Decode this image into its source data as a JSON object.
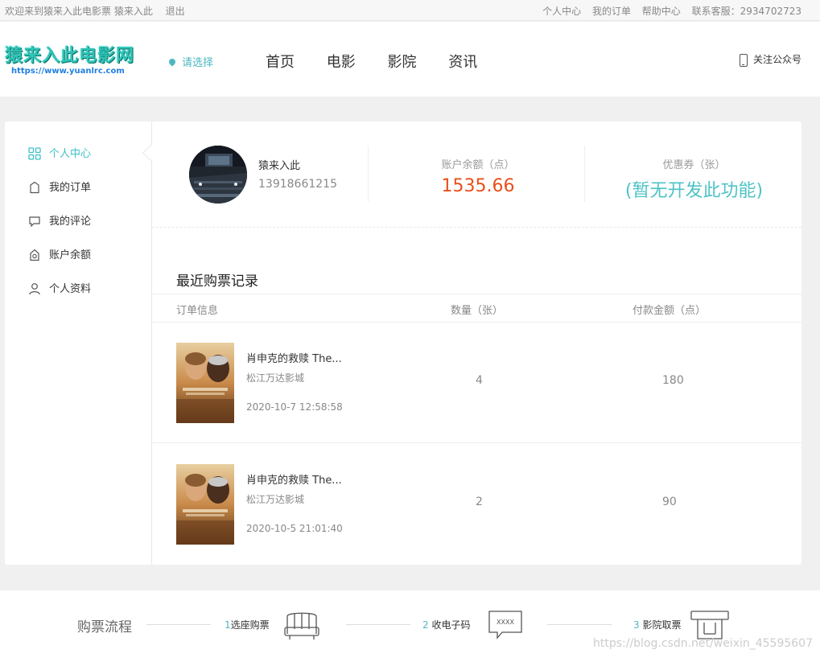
{
  "topbar": {
    "welcome": "欢迎来到猿来入此电影票 猿来入此",
    "logout": "退出",
    "links": [
      "个人中心",
      "我的订单",
      "帮助中心",
      "联系客服：2934702723"
    ]
  },
  "header": {
    "logo_name": "猿来入此电影网",
    "logo_url": "https://www.yuanlrc.com",
    "city_select": "请选择",
    "nav": [
      "首页",
      "电影",
      "影院",
      "资讯"
    ],
    "follow": "关注公众号"
  },
  "sidebar": {
    "items": [
      {
        "label": "个人中心",
        "icon": "grid-icon",
        "active": true
      },
      {
        "label": "我的订单",
        "icon": "bag-icon",
        "active": false
      },
      {
        "label": "我的评论",
        "icon": "comment-icon",
        "active": false
      },
      {
        "label": "账户余额",
        "icon": "wallet-icon",
        "active": false
      },
      {
        "label": "个人资料",
        "icon": "user-icon",
        "active": false
      }
    ]
  },
  "profile": {
    "username": "猿来入此",
    "phone": "13918661215",
    "balance_label": "账户余额（点）",
    "balance_value": "1535.66",
    "coupon_label": "优惠券（张）",
    "coupon_value": "(暂无开发此功能)"
  },
  "orders": {
    "title": "最近购票记录",
    "headers": {
      "info": "订单信息",
      "qty": "数量（张）",
      "amount": "付款金额（点）"
    },
    "rows": [
      {
        "movie": "肖申克的救赎 The...",
        "cinema": "松江万达影城",
        "time": "2020-10-7 12:58:58",
        "qty": "4",
        "amount": "180"
      },
      {
        "movie": "肖申克的救赎 The...",
        "cinema": "松江万达影城",
        "time": "2020-10-5 21:01:40",
        "qty": "2",
        "amount": "90"
      }
    ]
  },
  "footer": {
    "flow_title": "购票流程",
    "steps": [
      {
        "num": "1",
        "label": "选座购票"
      },
      {
        "num": "2",
        "label": "收电子码"
      },
      {
        "num": "3",
        "label": "影院取票"
      }
    ],
    "code_text": "XXXX",
    "watermark": "https://blog.csdn.net/weixin_45595607"
  },
  "colors": {
    "accent": "#3fc0c8",
    "balance": "#e8501c",
    "coupon": "#4fc3c6"
  }
}
